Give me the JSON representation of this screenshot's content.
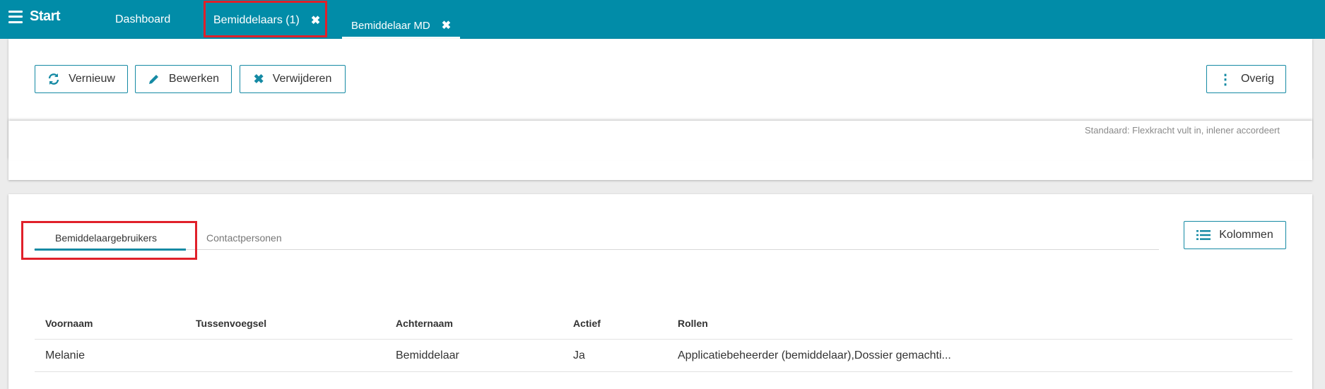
{
  "nav": {
    "start_label": "Start",
    "tabs": [
      {
        "label": "Dashboard"
      },
      {
        "label": "Bemiddelaars (1)"
      },
      {
        "label": "Bemiddelaar MD"
      }
    ]
  },
  "toolbar": {
    "refresh_label": "Vernieuw",
    "edit_label": "Bewerken",
    "delete_label": "Verwijderen",
    "more_label": "Overig"
  },
  "note_text": "Standaard: Flexkracht vult in, inlener accordeert",
  "subtabs": [
    {
      "label": "Bemiddelaargebruikers"
    },
    {
      "label": "Contactpersonen"
    }
  ],
  "columns_button": "Kolommen",
  "table": {
    "headers": [
      "Voornaam",
      "Tussenvoegsel",
      "Achternaam",
      "Actief",
      "Rollen"
    ],
    "rows": [
      [
        "Melanie",
        "",
        "Bemiddelaar",
        "Ja",
        "Applicatiebeheerder (bemiddelaar),Dossier gemachti..."
      ]
    ]
  },
  "colors": {
    "topbar": "#018ca8",
    "accent": "#158aa4",
    "highlight": "#e0202a"
  }
}
